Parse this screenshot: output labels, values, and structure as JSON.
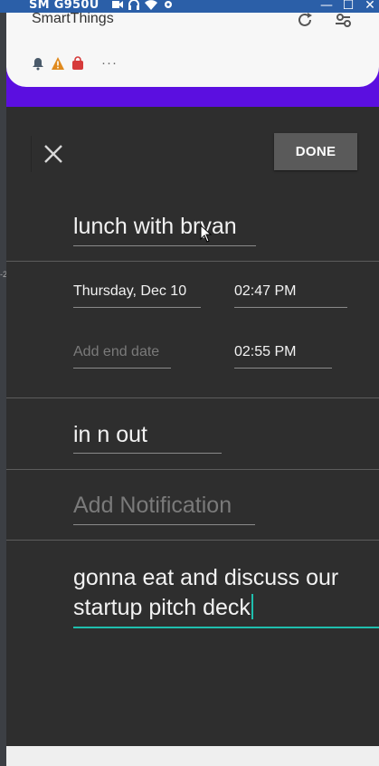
{
  "window": {
    "device_title": "SM G950U",
    "controls": [
      "—",
      "☐",
      "✕"
    ]
  },
  "notification": {
    "title": "SmartThings"
  },
  "editor": {
    "done_label": "DONE",
    "title": "lunch with bryan",
    "start_date": "Thursday, Dec 10",
    "start_time": "02:47 PM",
    "end_date_placeholder": "Add end date",
    "end_time": "02:55 PM",
    "location": "in n out",
    "notification_placeholder": "Add Notification",
    "description": "gonna eat and discuss our\nstartup pitch deck"
  },
  "colors": {
    "accent_teal": "#1fbfae",
    "notification_band": "#5b0fe0",
    "titlebar": "#2b5fa8"
  }
}
